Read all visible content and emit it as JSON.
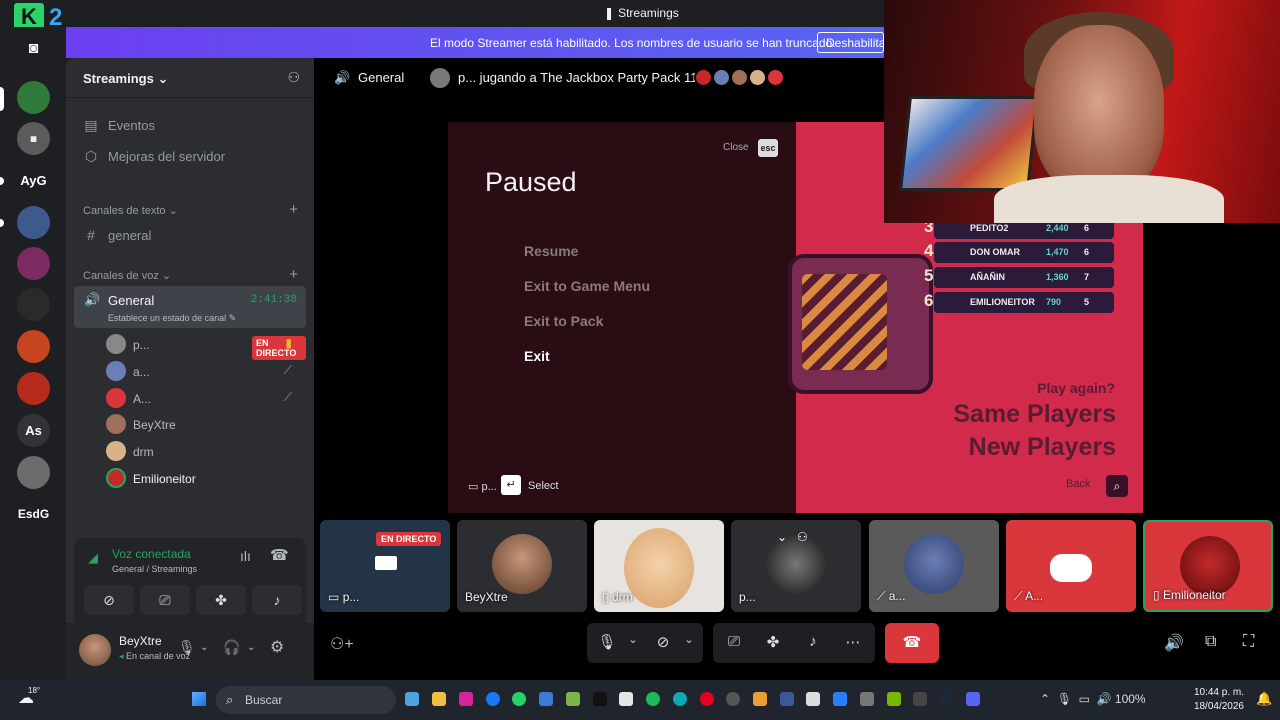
{
  "app": {
    "logo_letter": "K",
    "logo_num": "2",
    "window_title": "Streamings",
    "title_icon": "jackbox-icon"
  },
  "banner": {
    "text": "El modo Streamer está habilitado. Los nombres de usuario se han truncado.",
    "button": "Deshabilitar"
  },
  "servers": [
    {
      "label": "",
      "icon": "discord-home-icon",
      "color": "#1e1f22"
    },
    {
      "label": "",
      "icon": "server-avatar",
      "color": "#2f7a3a"
    },
    {
      "label": "",
      "icon": "server-avatar",
      "color": "#5b5b5b"
    },
    {
      "label": "AyG",
      "icon": "server-text",
      "color": "#1e1f22"
    },
    {
      "label": "",
      "icon": "server-avatar",
      "color": "#3c5b8c"
    },
    {
      "label": "",
      "icon": "server-avatar",
      "color": "#7c2a62"
    },
    {
      "label": "",
      "icon": "server-avatar",
      "color": "#2a2a2a"
    },
    {
      "label": "",
      "icon": "server-avatar",
      "color": "#c6451e"
    },
    {
      "label": "",
      "icon": "server-avatar",
      "color": "#b52a1a"
    },
    {
      "label": "As",
      "icon": "server-text",
      "color": "#313338"
    },
    {
      "label": "",
      "icon": "server-avatar",
      "color": "#6b6b6b"
    },
    {
      "label": "EsdG",
      "icon": "server-text",
      "color": "#1e1f22"
    }
  ],
  "sidebar": {
    "server_name": "Streamings",
    "events": "Eventos",
    "boosts": "Mejoras del servidor",
    "text_category": "Canales de texto",
    "text_channel": "general",
    "voice_category": "Canales de voz",
    "voice_channel": "General",
    "voice_timer": "2:41:38",
    "voice_status": "Establece un estado de canal",
    "voice_users": [
      {
        "name": "p...",
        "live": "EN DIRECTO",
        "color": "#888"
      },
      {
        "name": "a...",
        "live": "",
        "color": "#6b7fb5"
      },
      {
        "name": "A...",
        "live": "",
        "color": "#da373c"
      },
      {
        "name": "BeyXtre",
        "live": "",
        "color": "#a0705a"
      },
      {
        "name": "drm",
        "live": "",
        "color": "#d9b28a"
      },
      {
        "name": "Emilioneitor",
        "live": "",
        "color": "#c42a2a"
      }
    ]
  },
  "voice_panel": {
    "title": "Voz conectada",
    "subtitle": "General / Streamings"
  },
  "user": {
    "name": "BeyXtre",
    "status": "En canal de voz"
  },
  "channel_header": {
    "name": "General",
    "activity": "p... jugando a The Jackbox Party Pack 11"
  },
  "stream": {
    "pause_title": "Paused",
    "close": "Close",
    "esc": "esc",
    "menu": [
      "Resume",
      "Exit to Game Menu",
      "Exit to Pack",
      "Exit"
    ],
    "select": "Select",
    "select_prefix": "p...",
    "leaderboard": [
      {
        "pos": "3",
        "name": "PEDITO2",
        "score": "2,440",
        "likes": "6"
      },
      {
        "pos": "4",
        "name": "DON OMAR",
        "score": "1,470",
        "likes": "6"
      },
      {
        "pos": "5",
        "name": "AÑAÑIN",
        "score": "1,360",
        "likes": "7"
      },
      {
        "pos": "6",
        "name": "EMILIONEITOR",
        "score": "790",
        "likes": "5"
      }
    ],
    "play_again": "Play again?",
    "same_players": "Same Players",
    "new_players": "New Players",
    "back": "Back"
  },
  "tiles": [
    {
      "label": "p...",
      "live": "EN DIRECTO",
      "bg": "#243447"
    },
    {
      "label": "BeyXtre",
      "live": "",
      "bg": "#2b2d31"
    },
    {
      "label": "drm",
      "live": "",
      "bg": "#e7e3de"
    },
    {
      "label": "p...",
      "live": "",
      "bg": "#2b2d31"
    },
    {
      "label": "a...",
      "live": "",
      "bg": "#5a5a5a"
    },
    {
      "label": "A...",
      "live": "",
      "bg": "#da373c"
    },
    {
      "label": "Emilioneitor",
      "live": "",
      "bg": "#da373c"
    }
  ],
  "taskbar": {
    "weather": "18°",
    "search_placeholder": "Buscar",
    "battery": "100%",
    "time": "10:44 p. m.",
    "date": "18/04/2026"
  },
  "colors": {
    "accent": "#5865f2",
    "live_red": "#da373c",
    "green": "#23a55a"
  }
}
